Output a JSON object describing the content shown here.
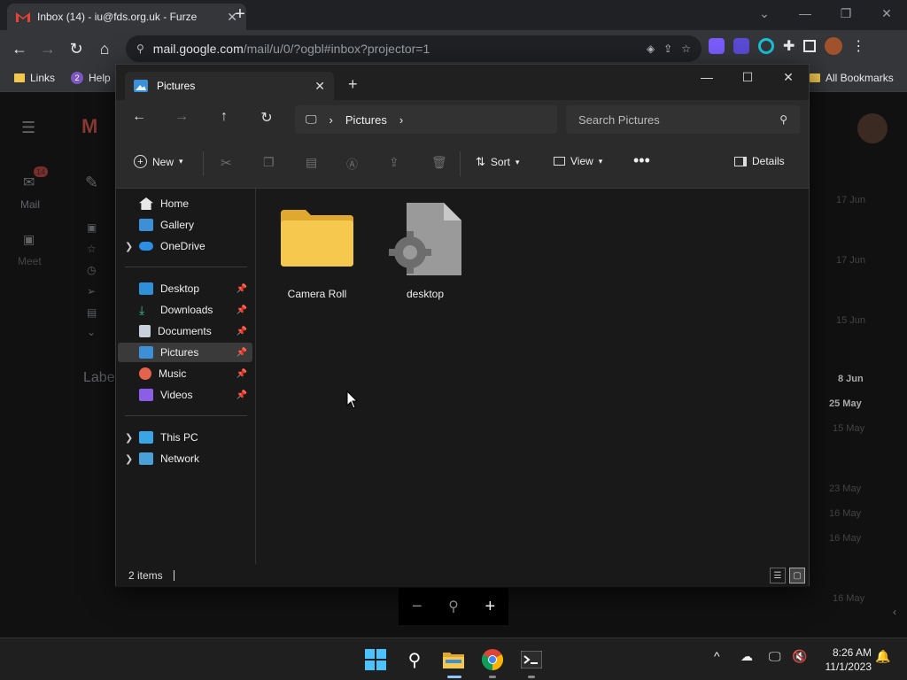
{
  "browser": {
    "tab_title": "Inbox (14) - iu@fds.org.uk - Furze",
    "url_host": "mail.google.com",
    "url_path": "/mail/u/0/?ogbl#inbox?projector=1",
    "bookmarks": [
      {
        "label": "Links"
      },
      {
        "label": "Help"
      }
    ],
    "all_bookmarks": "All Bookmarks"
  },
  "gmail": {
    "mail_label": "Mail",
    "meet_label": "Meet",
    "labels_heading": "Labels",
    "unread_badge": "14",
    "dates": [
      "17 Jun",
      "17 Jun",
      "15 Jun",
      "8 Jun",
      "25 May",
      "15 May",
      "23 May",
      "16 May",
      "16 May",
      "16 May"
    ]
  },
  "explorer": {
    "tab_title": "Pictures",
    "breadcrumb": [
      "Pictures"
    ],
    "search_placeholder": "Search Pictures",
    "toolbar": {
      "new_label": "New",
      "sort_label": "Sort",
      "view_label": "View",
      "details_label": "Details"
    },
    "nav": {
      "home": "Home",
      "gallery": "Gallery",
      "onedrive": "OneDrive",
      "desktop": "Desktop",
      "downloads": "Downloads",
      "documents": "Documents",
      "pictures": "Pictures",
      "music": "Music",
      "videos": "Videos",
      "thispc": "This PC",
      "network": "Network"
    },
    "items": [
      {
        "name": "Camera Roll",
        "kind": "folder"
      },
      {
        "name": "desktop",
        "kind": "ini-file"
      }
    ],
    "status": "2 items"
  },
  "taskbar": {
    "time": "8:26 AM",
    "date": "11/1/2023"
  },
  "colors": {
    "accent": "#8fc8ff",
    "folder": "#f6c94e",
    "selected": "#3a3a3a"
  }
}
